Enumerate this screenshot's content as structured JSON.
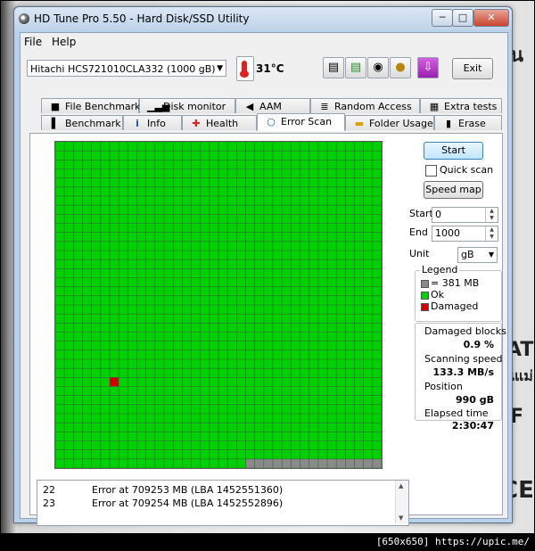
{
  "window": {
    "title": "HD Tune Pro 5.50 - Hard Disk/SSD Utility",
    "minimize_glyph": "─",
    "maximize_glyph": "□",
    "close_glyph": "✕"
  },
  "menu": {
    "file": "File",
    "help": "Help"
  },
  "toolbar": {
    "drive": "Hitachi HCS721010CLA332 (1000 gB)",
    "dropdown_glyph": "▼",
    "temperature": "31°C",
    "exit_label": "Exit",
    "icons": [
      "copy-text-icon",
      "copy-image-icon",
      "screenshot-camera-icon",
      "save-icon",
      "download-icon"
    ]
  },
  "tabs": {
    "top": [
      {
        "label": "File Benchmark",
        "icon": "file-benchmark-icon",
        "glyph": "■"
      },
      {
        "label": "Disk monitor",
        "icon": "disk-monitor-icon",
        "glyph": "▁▃▅"
      },
      {
        "label": "AAM",
        "icon": "speaker-icon",
        "glyph": "◀"
      },
      {
        "label": "Random Access",
        "icon": "random-access-icon",
        "glyph": "≣"
      },
      {
        "label": "Extra tests",
        "icon": "extra-tests-icon",
        "glyph": "▦"
      }
    ],
    "bottom": [
      {
        "label": "Benchmark",
        "icon": "benchmark-icon",
        "glyph": "▌"
      },
      {
        "label": "Info",
        "icon": "info-icon",
        "glyph": "i"
      },
      {
        "label": "Health",
        "icon": "health-cross-icon",
        "glyph": "✚"
      },
      {
        "label": "Error Scan",
        "icon": "magnifier-icon",
        "glyph": "○"
      },
      {
        "label": "Folder Usage",
        "icon": "folder-icon",
        "glyph": "▬"
      },
      {
        "label": "Erase",
        "icon": "trash-icon",
        "glyph": "▮"
      }
    ],
    "active": "Error Scan"
  },
  "scan": {
    "start_button": "Start",
    "quick_scan_label": "Quick scan",
    "quick_scan_checked": false,
    "speed_map_button": "Speed map",
    "start_label": "Start",
    "start_value": "0",
    "end_label": "End",
    "end_value": "1000",
    "unit_label": "Unit",
    "unit_value": "gB",
    "spin_up_glyph": "▲",
    "spin_down_glyph": "▼"
  },
  "grid": {
    "rows": 36,
    "cols": 36,
    "ok_color": "#00d100",
    "damaged_color": "#d30000",
    "unscanned_color": "#8a8a8a",
    "line_color": "#2e6b2e",
    "damaged_blocks": [
      [
        26,
        6
      ]
    ],
    "unscanned_start": [
      35,
      21
    ]
  },
  "legend": {
    "title": "Legend",
    "block_size": "= 381 MB",
    "ok": "Ok",
    "damaged": "Damaged"
  },
  "stats": {
    "damaged_blocks_label": "Damaged blocks",
    "damaged_blocks_value": "0.9 %",
    "scanning_speed_label": "Scanning speed",
    "scanning_speed_value": "133.3 MB/s",
    "position_label": "Position",
    "position_value": "990 gB",
    "elapsed_label": "Elapsed time",
    "elapsed_value": "2:30:47"
  },
  "log": {
    "rows": [
      {
        "index": "22",
        "message": "Error at 709253 MB (LBA 1452551360)"
      },
      {
        "index": "23",
        "message": "Error at 709254 MB (LBA 1452552896)"
      }
    ]
  },
  "background": {
    "text_1": "ั้น",
    "text_2": "ATI",
    "text_3": "นแม่",
    "text_4": "CE",
    "text_5": "F",
    "footer": "[650x650] https://upic.me/"
  }
}
